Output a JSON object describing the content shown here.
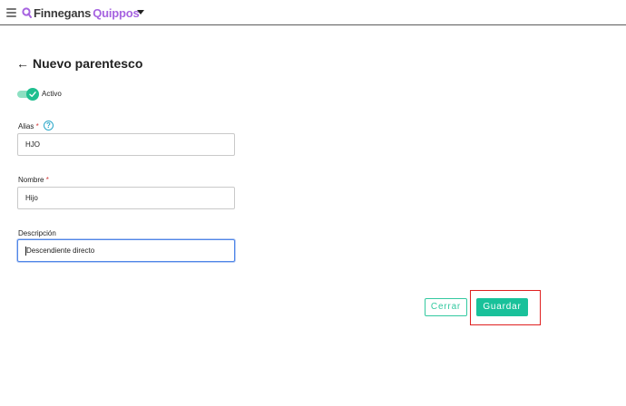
{
  "header": {
    "brand_primary": "Finnegans",
    "brand_secondary": "Quippos",
    "brand_color": "#a663e0"
  },
  "page": {
    "title": "Nuevo parentesco",
    "back_icon": "arrow-left-icon"
  },
  "active_toggle": {
    "label": "Activo",
    "on": true,
    "color": "#1fbf8f"
  },
  "form": {
    "alias": {
      "label": "Alias",
      "required_mark": "*",
      "value": "HJO",
      "help_icon": "help-circle-icon"
    },
    "nombre": {
      "label": "Nombre",
      "required_mark": "*",
      "value": "Hijo"
    },
    "descripcion": {
      "label": "Descripción",
      "value": "Descendiente directo"
    }
  },
  "actions": {
    "close_label": "Cerrar",
    "save_label": "Guardar",
    "accent_color": "#19c19a"
  }
}
